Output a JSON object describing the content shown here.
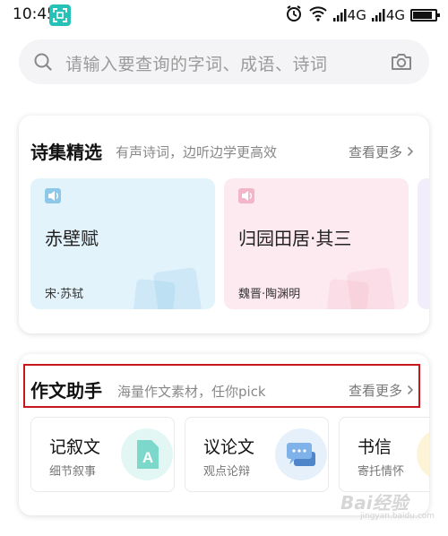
{
  "status_bar": {
    "time": "10:45",
    "network_1": "4G",
    "network_2": "4G",
    "battery_level": 0.8
  },
  "search": {
    "placeholder": "请输入要查询的字词、成语、诗词"
  },
  "poem_section": {
    "title": "诗集精选",
    "subtitle": "有声诗词，边听边学更高效",
    "more": "查看更多",
    "items": [
      {
        "title": "赤壁赋",
        "author": "宋·苏轼",
        "color": "#e3f3fc",
        "accent": "#8ec8e8"
      },
      {
        "title": "归园田居·其三",
        "author": "魏晋·陶渊明",
        "color": "#fdeaf0",
        "accent": "#f2b6c8"
      }
    ]
  },
  "essay_section": {
    "title": "作文助手",
    "subtitle": "海量作文素材，任你pick",
    "more": "查看更多",
    "items": [
      {
        "title": "记叙文",
        "desc": "细节叙事",
        "icon": "document-a-icon",
        "color": "#e2f7f4"
      },
      {
        "title": "议论文",
        "desc": "观点论辩",
        "icon": "chat-bubbles-icon",
        "color": "#e6f0fb"
      },
      {
        "title": "书信",
        "desc": "寄托情怀",
        "icon": "letter-icon",
        "color": "#fdf3d6"
      }
    ]
  },
  "watermark": {
    "text": "Bai经验",
    "sub": "jingyan.baidu.com"
  },
  "colors": {
    "highlight": "#c8161d",
    "teal": "#26c2b8"
  }
}
